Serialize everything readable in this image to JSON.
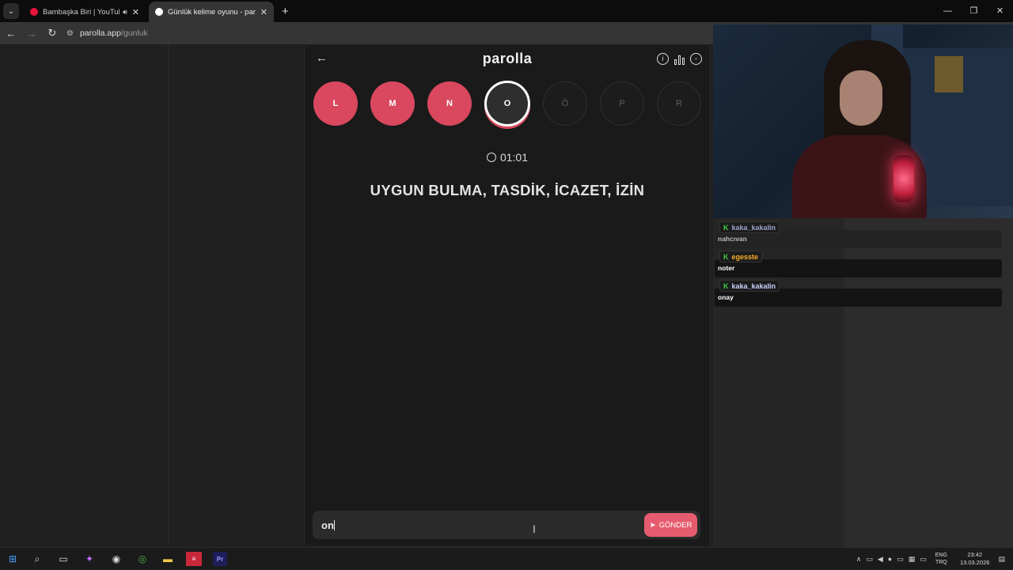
{
  "browser": {
    "tabs": [
      {
        "title": "Bambaşka Biri | YouTube Music",
        "favicon_color": "#e8143a"
      },
      {
        "title": "Günlük kelime oyunu - parolla",
        "favicon_color": "#ffffff"
      }
    ],
    "url_host": "parolla.app",
    "url_path": "/gunluk"
  },
  "app": {
    "logo": "parolla",
    "letters": [
      {
        "char": "L",
        "state": "done"
      },
      {
        "char": "M",
        "state": "done"
      },
      {
        "char": "N",
        "state": "done"
      },
      {
        "char": "O",
        "state": "current"
      },
      {
        "char": "Ö",
        "state": "todo"
      },
      {
        "char": "P",
        "state": "todo"
      },
      {
        "char": "R",
        "state": "todo"
      }
    ],
    "timer": "01:01",
    "clue": "UYGUN BULMA, TASDİK, İCAZET, İZİN",
    "input_value": "on",
    "send_label": "GÖNDER"
  },
  "chat": {
    "messages": [
      {
        "user": "kaka_kakalin",
        "user_color": "#9aa4c8",
        "text": "nahcıvan"
      },
      {
        "user": "egesste",
        "user_color": "#ffae2a",
        "text": "noter"
      },
      {
        "user": "kaka_kakalin",
        "user_color": "#c8d2ff",
        "text": "onay"
      }
    ]
  },
  "taskbar": {
    "lang_1": "ENG",
    "lang_2": "TRQ",
    "time": "23:42",
    "date": "13.03.2026"
  },
  "colors": {
    "accent": "#d9485e",
    "send": "#e65c6e"
  }
}
